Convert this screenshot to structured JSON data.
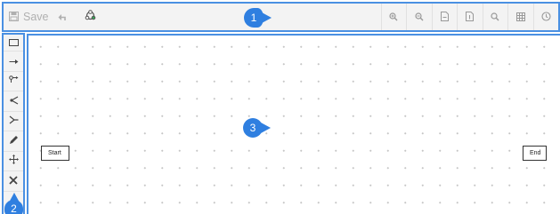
{
  "toolbar": {
    "save_label": "Save",
    "left_buttons": [
      "save-icon",
      "undo-icon",
      "rearrange-icon"
    ],
    "right_buttons": [
      "zoom-in-icon",
      "zoom-out-icon",
      "export-icon",
      "import-icon",
      "search-icon",
      "grid-icon",
      "help-icon"
    ]
  },
  "sidebar": {
    "tools": [
      "rectangle-tool-icon",
      "arrow-tool-icon",
      "connector-tool-icon",
      "branch-tool-icon",
      "merge-tool-icon",
      "pencil-tool-icon",
      "move-tool-icon",
      "delete-tool-icon"
    ]
  },
  "canvas": {
    "nodes": [
      {
        "label": "Start"
      },
      {
        "label": "End"
      }
    ]
  },
  "markers": {
    "one": "1",
    "two": "2",
    "three": "3"
  },
  "colors": {
    "accent": "#4a90e2",
    "marker": "#2f7fe0",
    "toolbar_bg": "#f3f3f3"
  }
}
